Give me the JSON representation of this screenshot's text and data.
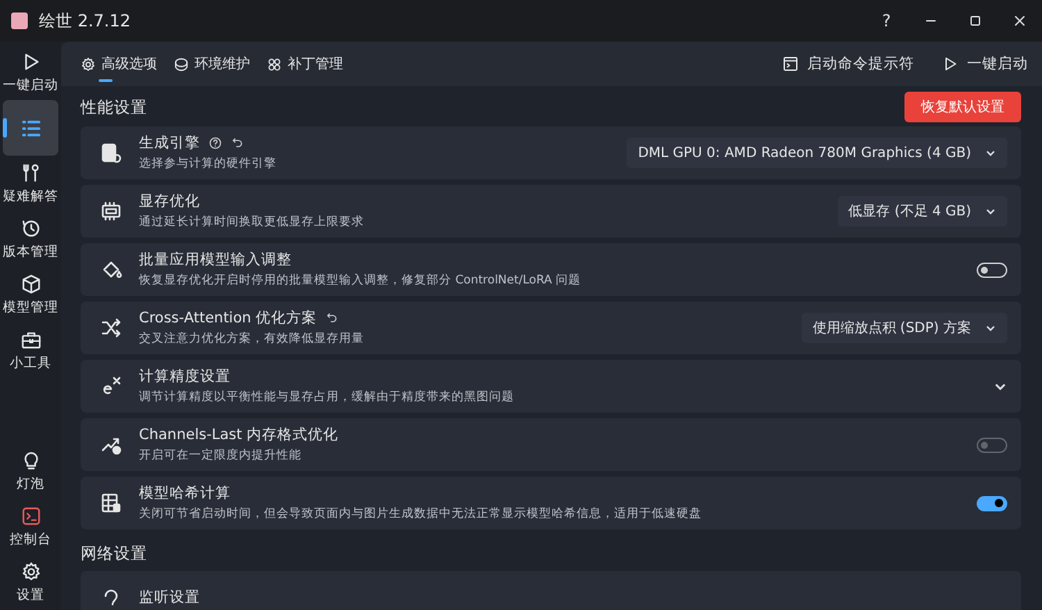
{
  "window": {
    "title": "绘世 2.7.12",
    "controls": [
      "?"
    ]
  },
  "sidebar": {
    "items": [
      {
        "label": "一键启动",
        "selected": false
      },
      {
        "selected": true
      },
      {
        "label": "疑难解答",
        "selected": false
      },
      {
        "label": "版本管理",
        "selected": false
      },
      {
        "label": "模型管理",
        "selected": false
      },
      {
        "label": "小工具",
        "selected": false
      }
    ],
    "bottom_items": [
      {
        "label": "灯泡",
        "selected": false
      },
      {
        "label": "控制台",
        "selected": false
      },
      {
        "label": "设置",
        "selected": false
      }
    ]
  },
  "tabs": [
    {
      "label": "高级选项",
      "selected": true
    },
    {
      "label": "环境维护",
      "selected": false
    },
    {
      "label": "补丁管理",
      "selected": false
    }
  ],
  "toolbar": [
    {
      "label": "启动命令提示符"
    },
    {
      "label": "一键启动"
    }
  ],
  "sections": [
    {
      "title": "性能设置",
      "action": "恢复默认设置",
      "rows": [
        {
          "kind": "dropdown",
          "title": "生成引擎",
          "help": true,
          "reset": true,
          "subtitle": "选择参与计算的硬件引擎",
          "value": "DML GPU 0: AMD Radeon 780M Graphics (4 GB)"
        },
        {
          "kind": "dropdown",
          "title": "显存优化",
          "help": false,
          "reset": false,
          "subtitle": "通过延长计算时间换取更低显存上限要求",
          "value": "低显存 (不足 4 GB)"
        },
        {
          "kind": "toggle",
          "title": "批量应用模型输入调整",
          "help": false,
          "reset": false,
          "subtitle": "恢复显存优化开启时停用的批量模型输入调整，修复部分 ControlNet/LoRA 问题",
          "on": false,
          "disabled": false
        },
        {
          "kind": "dropdown",
          "title": "Cross-Attention 优化方案",
          "help": false,
          "reset": true,
          "subtitle": "交叉注意力优化方案，有效降低显存用量",
          "value": "使用缩放点积 (SDP) 方案"
        },
        {
          "kind": "expander",
          "title": "计算精度设置",
          "help": false,
          "reset": false,
          "subtitle": "调节计算精度以平衡性能与显存占用，缓解由于精度带来的黑图问题",
          "expanded": false
        },
        {
          "kind": "toggle",
          "title": "Channels-Last 内存格式优化",
          "help": false,
          "reset": false,
          "subtitle": "开启可在一定限度内提升性能",
          "on": false,
          "disabled": true
        },
        {
          "kind": "toggle",
          "title": "模型哈希计算",
          "help": false,
          "reset": false,
          "subtitle": "关闭可节省启动时间，但会导致页面内与图片生成数据中无法正常显示模型哈希信息，适用于低速硬盘",
          "on": true,
          "disabled": false
        }
      ]
    },
    {
      "title": "网络设置",
      "rows": [
        {
          "kind": "plain",
          "title": "监听设置",
          "help": false,
          "reset": false
        }
      ]
    }
  ]
}
